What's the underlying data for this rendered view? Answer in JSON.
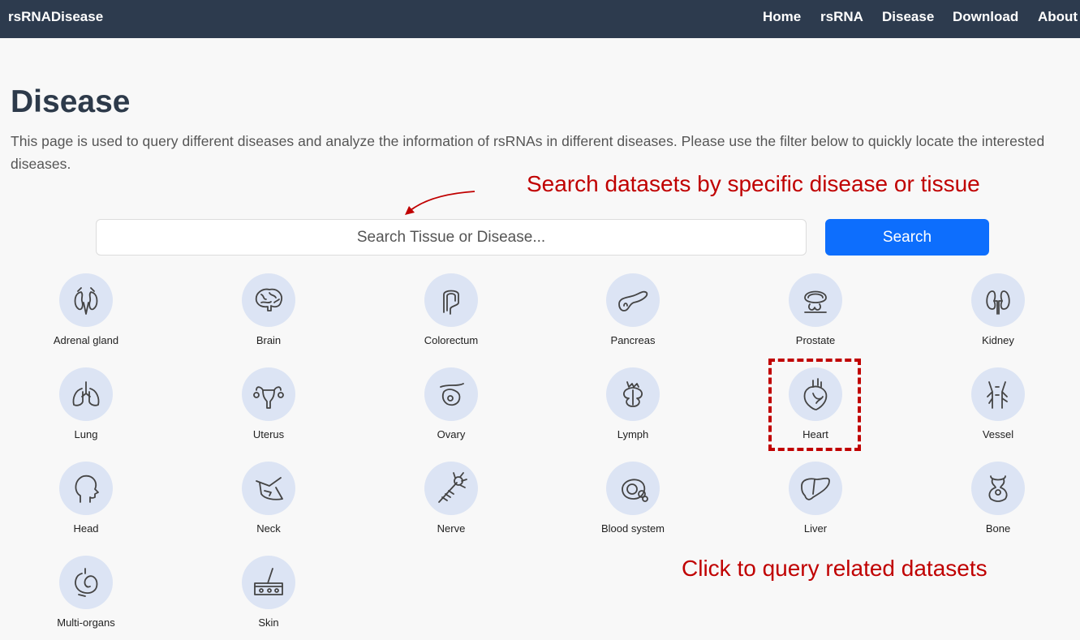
{
  "navbar": {
    "brand": "rsRNADisease",
    "links": [
      "Home",
      "rsRNA",
      "Disease",
      "Download",
      "About"
    ]
  },
  "page": {
    "title": "Disease",
    "description": "This page is used to query different diseases and analyze the information of rsRNAs in different diseases. Please use the filter below to quickly locate the interested diseases."
  },
  "annotations": {
    "search_note": "Search datasets by specific disease or tissue",
    "click_note": "Click to query related datasets"
  },
  "search": {
    "placeholder": "Search Tissue or Disease...",
    "button_label": "Search"
  },
  "organs": [
    {
      "label": "Adrenal gland",
      "icon": "adrenal-gland-icon"
    },
    {
      "label": "Brain",
      "icon": "brain-icon"
    },
    {
      "label": "Colorectum",
      "icon": "colorectum-icon"
    },
    {
      "label": "Pancreas",
      "icon": "pancreas-icon"
    },
    {
      "label": "Prostate",
      "icon": "prostate-icon"
    },
    {
      "label": "Kidney",
      "icon": "kidney-icon"
    },
    {
      "label": "Lung",
      "icon": "lung-icon"
    },
    {
      "label": "Uterus",
      "icon": "uterus-icon"
    },
    {
      "label": "Ovary",
      "icon": "ovary-icon"
    },
    {
      "label": "Lymph",
      "icon": "lymph-icon"
    },
    {
      "label": "Heart",
      "icon": "heart-icon"
    },
    {
      "label": "Vessel",
      "icon": "vessel-icon"
    },
    {
      "label": "Head",
      "icon": "head-icon"
    },
    {
      "label": "Neck",
      "icon": "neck-icon"
    },
    {
      "label": "Nerve",
      "icon": "nerve-icon"
    },
    {
      "label": "Blood system",
      "icon": "blood-system-icon"
    },
    {
      "label": "Liver",
      "icon": "liver-icon"
    },
    {
      "label": "Bone",
      "icon": "bone-icon"
    },
    {
      "label": "Multi-organs",
      "icon": "multi-organs-icon"
    },
    {
      "label": "Skin",
      "icon": "skin-icon"
    }
  ],
  "colors": {
    "navbar": "#2d3b4e",
    "accent": "#0d6efd",
    "annotation": "#c00000",
    "icon_circle": "#dce4f4"
  }
}
